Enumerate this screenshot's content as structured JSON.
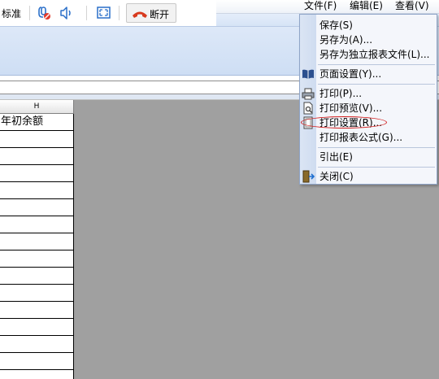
{
  "call_toolbar": {
    "quality_label": "标准",
    "hangup_label": "断开"
  },
  "menubar": {
    "items": [
      "文件(F)",
      "编辑(E)",
      "查看(V)"
    ]
  },
  "sheet": {
    "column_letter": "H",
    "header_cell": "年初余额"
  },
  "file_menu": {
    "items": [
      {
        "label": "保存(S)",
        "icon": ""
      },
      {
        "label": "另存为(A)...",
        "icon": ""
      },
      {
        "label": "另存为独立报表文件(L)...",
        "icon": ""
      },
      {
        "label": "页面设置(Y)...",
        "icon": "open-book-icon"
      },
      {
        "label": "打印(P)...",
        "icon": "printer-icon"
      },
      {
        "label": "打印预览(V)...",
        "icon": "print-preview-icon"
      },
      {
        "label": "打印设置(R)...",
        "icon": "print-setup-icon"
      },
      {
        "label": "打印报表公式(G)...",
        "icon": ""
      },
      {
        "label": "引出(E)",
        "icon": ""
      },
      {
        "label": "关闭(C)",
        "icon": "exit-door-icon"
      }
    ]
  },
  "colors": {
    "highlight_ellipse": "#d42020",
    "hangup_red": "#d83a1e"
  }
}
